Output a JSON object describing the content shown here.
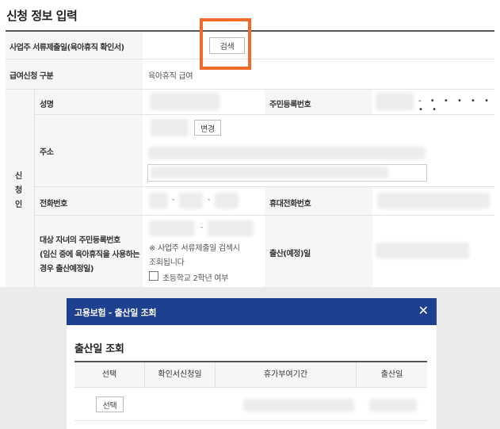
{
  "page_title": "신청 정보 입력",
  "rows": {
    "doc_submit": {
      "label": "사업주 서류제출일(육아휴직 확인서)",
      "button": "검색"
    },
    "benefit_type": {
      "label": "급여신청 구분",
      "value": "육아휴직 급여"
    }
  },
  "applicant": {
    "section_chars": [
      "신",
      "청",
      "인"
    ],
    "name_label": "성명",
    "rrn_label": "주민등록번호",
    "rrn_masked": "- • • • • • • •",
    "address_label": "주소",
    "change_button": "변경",
    "phone_label": "전화번호",
    "phone_sep1": "-",
    "phone_sep2": "-",
    "mobile_label": "휴대전화번호",
    "child_label_1": "대상 자녀의 주민등록번호",
    "child_label_2": "(임신 중에 육아휴직을 사용하는",
    "child_label_3": "경우 출산예정일)",
    "child_sep": "-",
    "child_note_1": "※ 사업주 서류제출일 검색시",
    "child_note_2": "조회됩니다",
    "checkbox_label": "초등학교 2학년 여부",
    "birth_label": "출산(예정)일"
  },
  "modal": {
    "header_title": "고용보험 - 출산일 조회",
    "close_glyph": "✕",
    "subtitle": "출산일 조회",
    "columns": [
      "선택",
      "확인서신청일",
      "휴가부여기간",
      "출산일"
    ],
    "row_button": "선택"
  },
  "colors": {
    "header_blue": "#1f3f8f",
    "highlight": "#f06a2a",
    "label_bg": "#f6f6f6"
  }
}
